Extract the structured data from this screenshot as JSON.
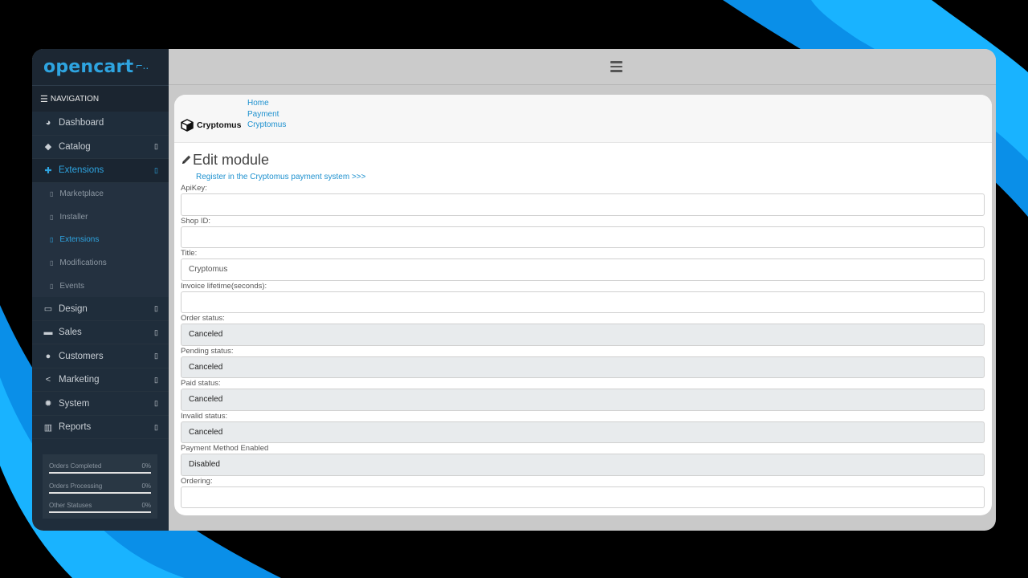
{
  "colors": {
    "accent": "#2ea4e0",
    "link": "#1e91cf",
    "sidebar_bg": "#1f2d3b",
    "swoosh": "#0a9cf2"
  },
  "brand": {
    "name": "opencart",
    "cart_glyph": "⌐.."
  },
  "navigation": {
    "header": "NAVIGATION",
    "items": [
      {
        "label": "Dashboard",
        "icon": "dashboard-icon"
      },
      {
        "label": "Catalog",
        "icon": "tag-icon"
      },
      {
        "label": "Extensions",
        "icon": "puzzle-icon",
        "active": true
      },
      {
        "label": "Design",
        "icon": "monitor-icon"
      },
      {
        "label": "Sales",
        "icon": "cart-icon"
      },
      {
        "label": "Customers",
        "icon": "user-icon"
      },
      {
        "label": "Marketing",
        "icon": "share-icon"
      },
      {
        "label": "System",
        "icon": "gear-icon"
      },
      {
        "label": "Reports",
        "icon": "bar-chart-icon"
      }
    ],
    "extensions_sub": [
      {
        "label": "Marketplace"
      },
      {
        "label": "Installer"
      },
      {
        "label": "Extensions",
        "active": true
      },
      {
        "label": "Modifications"
      },
      {
        "label": "Events"
      }
    ]
  },
  "stats": [
    {
      "label": "Orders Completed",
      "value": "0%"
    },
    {
      "label": "Orders Processing",
      "value": "0%"
    },
    {
      "label": "Other Statuses",
      "value": "0%"
    }
  ],
  "header": {
    "logo_text": "Cryptomus",
    "breadcrumb": [
      "Home",
      "Payment",
      "Cryptomus"
    ]
  },
  "form": {
    "title": "Edit module",
    "register_link": "Register in the Cryptomus payment system >>>",
    "fields": [
      {
        "label": "ApiKey:",
        "value": ""
      },
      {
        "label": "Shop ID:",
        "value": ""
      },
      {
        "label": "Title:",
        "value": "Cryptomus"
      },
      {
        "label": "Invoice lifetime(seconds):",
        "value": ""
      },
      {
        "label": "Order status:",
        "value": "Canceled"
      },
      {
        "label": "Pending status:",
        "value": "Canceled"
      },
      {
        "label": "Paid status:",
        "value": "Canceled"
      },
      {
        "label": "Invalid status:",
        "value": "Canceled"
      },
      {
        "label": "Payment Method Enabled",
        "value": "Disabled"
      },
      {
        "label": "Ordering:",
        "value": ""
      }
    ]
  }
}
